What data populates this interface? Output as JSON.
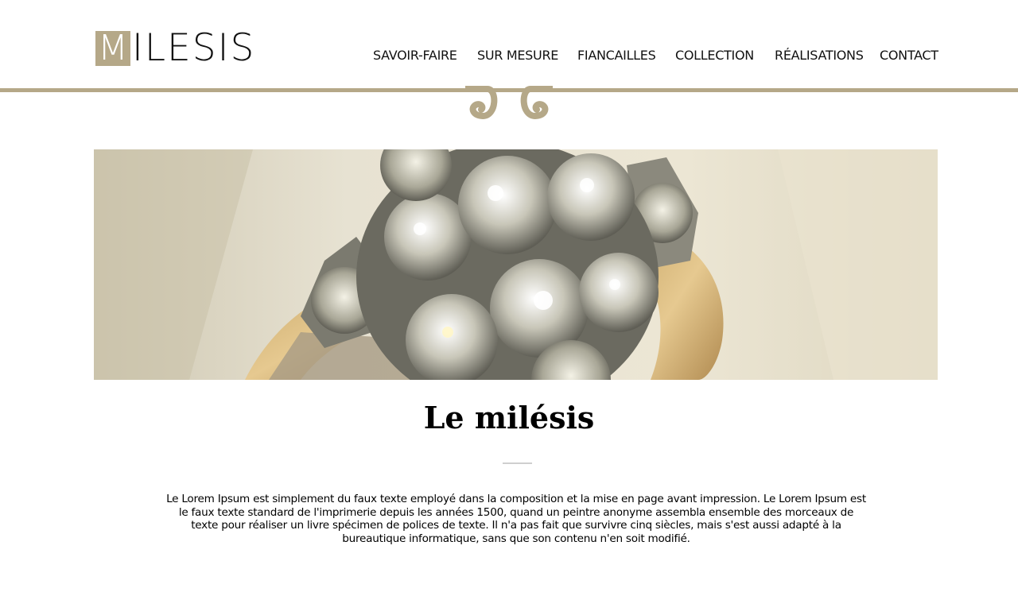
{
  "brand": {
    "logo_initial": "M",
    "logo_rest": "ILESIS"
  },
  "nav": {
    "items": [
      {
        "label": "SAVOIR-FAIRE"
      },
      {
        "label": "SUR MESURE"
      },
      {
        "label": "FIANCAILLES"
      },
      {
        "label": "COLLECTION"
      },
      {
        "label": "RÉALISATIONS"
      },
      {
        "label": "CONTACT"
      }
    ]
  },
  "colors": {
    "accent": "#b5a888",
    "divider": "#cfcfcf"
  },
  "main": {
    "title": "Le milésis",
    "body": "Le Lorem Ipsum est simplement du faux texte employé dans la composition et la mise en page avant impression. Le Lorem Ipsum est le faux texte standard de l'imprimerie depuis les années 1500, quand un peintre anonyme assembla ensemble des morceaux de texte pour réaliser un livre spécimen de polices de texte. Il n'a pas fait que survivre cinq siècles, mais s'est aussi adapté à la bureautique informatique, sans que son contenu n'en soit modifié."
  }
}
